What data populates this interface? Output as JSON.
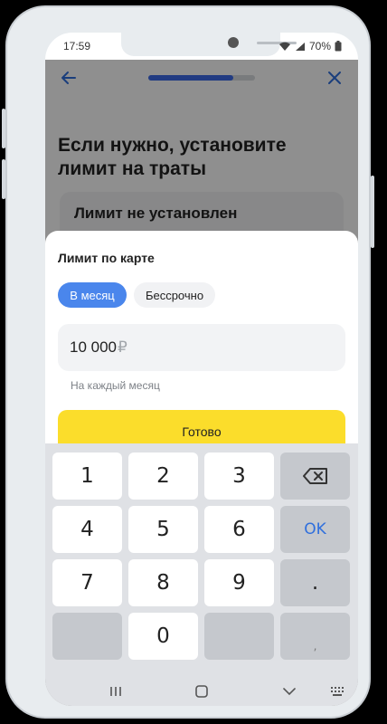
{
  "status_bar": {
    "time": "17:59",
    "battery": "70%"
  },
  "header": {
    "progress": 0.8
  },
  "page": {
    "title": "Если нужно, установите лимит на траты",
    "card_label": "Лимит не установлен"
  },
  "sheet": {
    "title": "Лимит по карте",
    "segments": {
      "monthly": "В месяц",
      "unlimited": "Бессрочно"
    },
    "amount": "10 000",
    "currency": "₽",
    "hint": "На каждый месяц",
    "done_label": "Готово"
  },
  "keyboard": {
    "keys": [
      "1",
      "2",
      "3",
      "4",
      "5",
      "6",
      "7",
      "8",
      "9",
      "0"
    ],
    "ok_label": "OK",
    "dot_label": ".",
    "comma_label": ","
  },
  "icons": {
    "back": "arrow-left",
    "close": "x",
    "backspace": "backspace",
    "nav_recent": "three-bars",
    "nav_home": "rounded-square",
    "nav_back": "chevron-down",
    "nav_keyboard": "keyboard-grid"
  },
  "colors": {
    "accent": "#3b6ae8",
    "primary_button": "#fbdd2b",
    "segment_active": "#4a86ec"
  }
}
